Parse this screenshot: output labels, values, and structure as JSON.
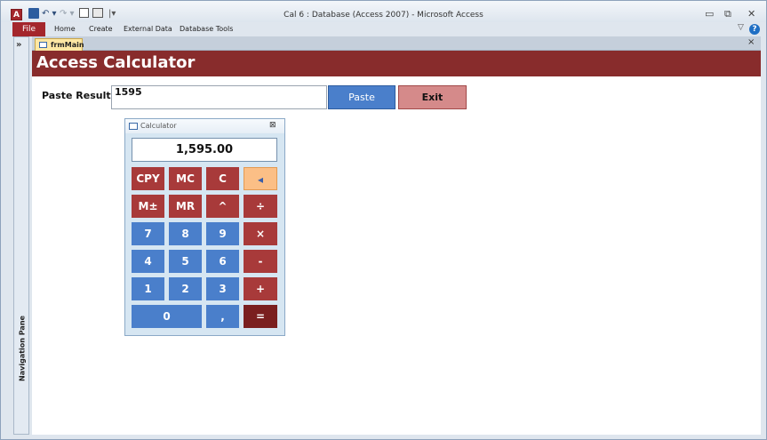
{
  "window": {
    "title": "Cal 6 : Database (Access 2007)  -  Microsoft Access",
    "app_icon_letter": "A",
    "controls": {
      "minimize": "▭",
      "restore": "⧉",
      "close": "✕"
    }
  },
  "quick_access": {
    "undo": "↶ ▾",
    "redo": "↷ ▾",
    "customize": "|▾"
  },
  "ribbon": {
    "file": "File",
    "tabs": [
      "Home",
      "Create",
      "External Data",
      "Database Tools"
    ],
    "minimize_glyph": "▽",
    "help_glyph": "?"
  },
  "navigation_pane": {
    "toggle": "»",
    "label": "Navigation Pane"
  },
  "document_tab": {
    "label": "frmMain",
    "close": "×"
  },
  "form": {
    "title": "Access Calculator",
    "paste_label": "Paste Result",
    "paste_value": "1595",
    "paste_button": "Paste",
    "exit_button": "Exit"
  },
  "calculator": {
    "title": "Calculator",
    "close": "⊠",
    "display": "1,595.00",
    "keys": {
      "cpy": "CPY",
      "mc": "MC",
      "c": "C",
      "back": "◂",
      "mpm": "M±",
      "mr": "MR",
      "pow": "^",
      "div": "÷",
      "k7": "7",
      "k8": "8",
      "k9": "9",
      "mul": "×",
      "k4": "4",
      "k5": "5",
      "k6": "6",
      "sub": "-",
      "k1": "1",
      "k2": "2",
      "k3": "3",
      "add": "+",
      "k0": "0",
      "dec": ",",
      "eq": "="
    }
  },
  "colors": {
    "header": "#882c2c",
    "blue_key": "#4a7fcb",
    "red_key": "#a83a3a",
    "equals_key": "#7a1f1f",
    "backspace_key": "#fbbf86"
  }
}
